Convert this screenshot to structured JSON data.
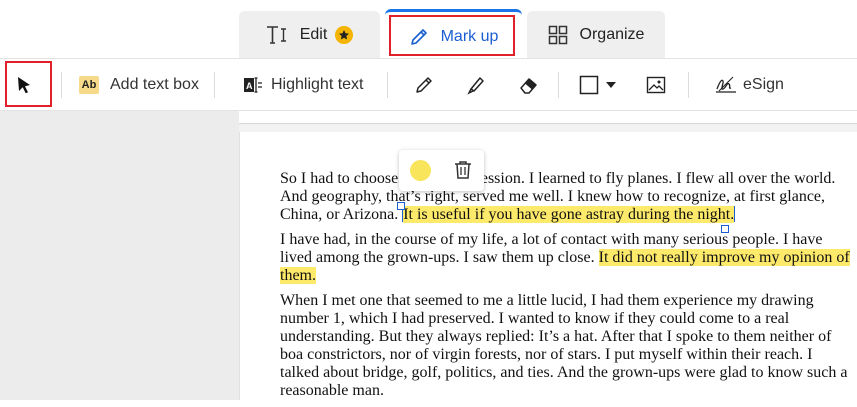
{
  "tabs": {
    "edit": {
      "label": "Edit"
    },
    "markup": {
      "label": "Mark up"
    },
    "organize": {
      "label": "Organize"
    }
  },
  "toolbar": {
    "add_text_box": "Add text box",
    "highlight_text": "Highlight text",
    "esign": "eSign",
    "add_text_icon_text": "Ab"
  },
  "colors": {
    "accent": "#1a73e8",
    "highlight": "#fde96a",
    "annotation_red": "#e0212a",
    "premium_star": "#f4b400"
  },
  "document": {
    "p1_before": "So I had to choose another profession. I learned to fly planes. I flew all over the world. And geography, that’s right, served me well. I knew how to recognize, at first glance, China, or Arizona. ",
    "p1_highlight": "It is useful if you have gone astray during the night.",
    "p2_before": "I have had, in the course of my life, a lot of contact with many serious people. I have lived among the grown-ups. I saw them up close. ",
    "p2_highlight": "It did not really improve my opinion of them.",
    "p3": "When I met one that seemed to me a little lucid, I had them experience my drawing number 1, which I had preserved. I wanted to know if they could come to a real understanding. But they always replied: It’s a hat. After that I spoke to them neither of boa constrictors, nor of virgin forests, nor of stars. I put myself within their reach. I talked about bridge, golf, politics, and ties. And the grown-ups were glad to know such a reasonable man."
  }
}
